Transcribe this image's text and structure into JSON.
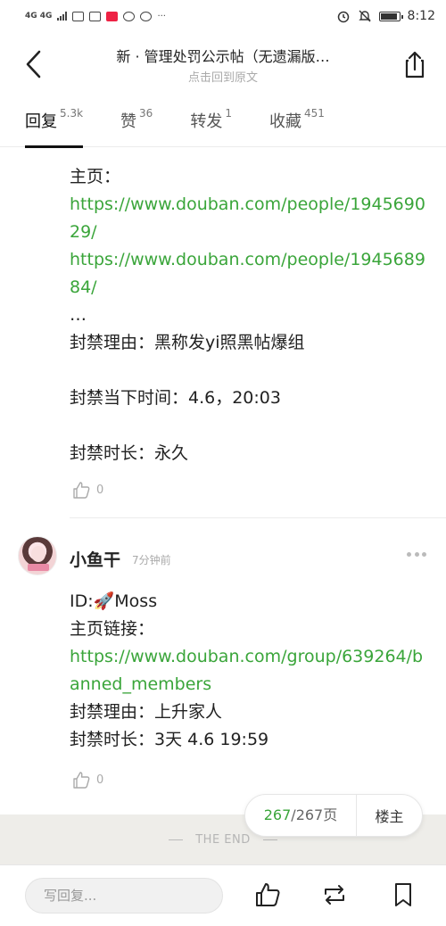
{
  "status_bar": {
    "left_label": "4G 4G",
    "time": "8:12",
    "battery_level": 0.9
  },
  "header": {
    "title": "新 · 管理处罚公示帖（无遗漏版…",
    "subtitle": "点击回到原文"
  },
  "tabs": [
    {
      "label": "回复",
      "count": "5.3k",
      "active": true
    },
    {
      "label": "赞",
      "count": "36",
      "active": false
    },
    {
      "label": "转发",
      "count": "1",
      "active": false
    },
    {
      "label": "收藏",
      "count": "451",
      "active": false
    }
  ],
  "prev_comment": {
    "lines": [
      {
        "text": "主页：",
        "link": false
      },
      {
        "text": "https://www.douban.com/people/194569029/",
        "link": true
      },
      {
        "text": "https://www.douban.com/people/194568984/",
        "link": true
      },
      {
        "text": "…",
        "link": false
      },
      {
        "text": "封禁理由：黑称发yi照黑帖爆组",
        "link": false
      },
      {
        "text": "",
        "link": false
      },
      {
        "text": "封禁当下时间：4.6，20:03",
        "link": false
      },
      {
        "text": "",
        "link": false
      },
      {
        "text": "封禁时长：永久",
        "link": false
      }
    ],
    "likes": "0"
  },
  "comment": {
    "name": "小鱼干",
    "time": "7分钟前",
    "lines": [
      {
        "text": "ID:🚀Moss",
        "link": false
      },
      {
        "text": "主页链接：",
        "link": false
      },
      {
        "text": "https://www.douban.com/group/639264/banned_members",
        "link": true
      },
      {
        "text": "封禁理由：上升家人",
        "link": false
      },
      {
        "text": "封禁时长：3天 4.6 19:59",
        "link": false
      }
    ],
    "likes": "0"
  },
  "pager": {
    "current": "267",
    "total_text": "/267页",
    "op_label": "楼主"
  },
  "end_text": "THE END",
  "bottom_bar": {
    "reply_placeholder": "写回复..."
  },
  "colors": {
    "link": "#3aa53a",
    "accent_tab": "#111111",
    "end_band": "#eeede9"
  }
}
